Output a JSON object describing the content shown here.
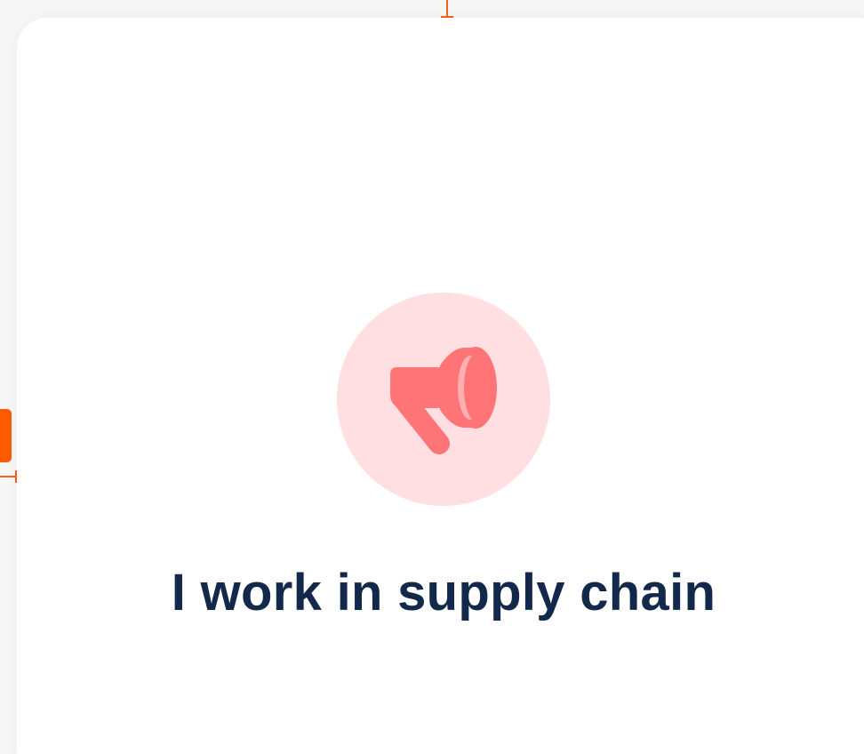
{
  "card": {
    "title": "I work in supply chain",
    "icon": "megaphone-icon"
  },
  "colors": {
    "icon_circle_bg": "#ffdfe1",
    "icon_fill": "#ff7577",
    "title_text": "#13294b",
    "guide_marker": "#f4621f",
    "side_tab": "#ff5a00"
  }
}
